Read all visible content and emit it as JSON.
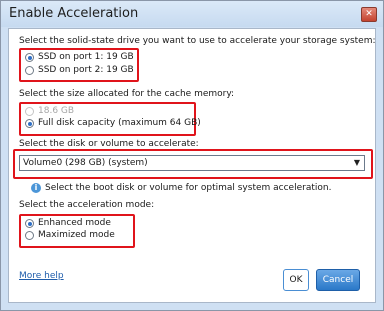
{
  "window": {
    "title": "Enable Acceleration",
    "close_glyph": "✕",
    "close_icon": "close-icon"
  },
  "ssd_section": {
    "label": "Select the solid-state drive you want to use to accelerate your storage system:",
    "options": [
      {
        "label": "SSD on port 1: 19 GB",
        "checked": true
      },
      {
        "label": "SSD on port 2: 19 GB",
        "checked": false
      }
    ]
  },
  "cache_section": {
    "label": "Select the size allocated for the cache memory:",
    "options": [
      {
        "label": "18.6 GB",
        "checked": false,
        "disabled": true
      },
      {
        "label": "Full disk capacity (maximum 64 GB)",
        "checked": true
      }
    ]
  },
  "volume_section": {
    "label": "Select the disk or volume to accelerate:",
    "selected": "Volume0 (298 GB) (system)",
    "arrow": "▼",
    "hint": "Select the boot disk or volume for optimal system acceleration.",
    "hint_icon": "info-icon"
  },
  "mode_section": {
    "label": "Select the acceleration mode:",
    "options": [
      {
        "label": "Enhanced mode",
        "checked": true
      },
      {
        "label": "Maximized mode",
        "checked": false
      }
    ]
  },
  "footer": {
    "more_help": "More help",
    "ok": "OK",
    "cancel": "Cancel"
  },
  "colors": {
    "highlight": "#e0141b",
    "accent": "#2a78c8",
    "link": "#1f5dab"
  }
}
